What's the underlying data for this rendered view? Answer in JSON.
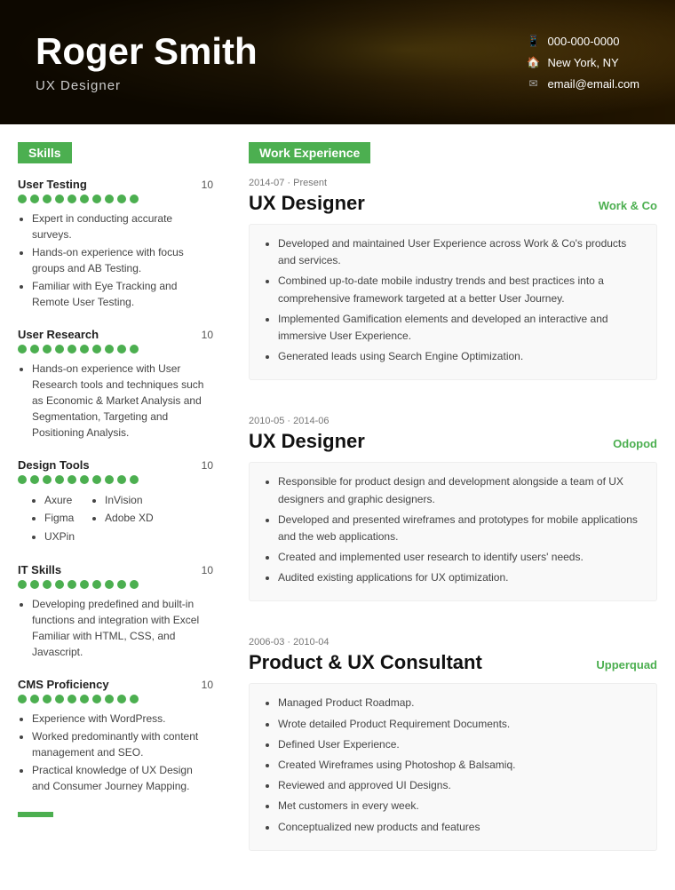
{
  "header": {
    "name": "Roger Smith",
    "title": "UX Designer",
    "phone": "000-000-0000",
    "location": "New York, NY",
    "email": "email@email.com"
  },
  "sections": {
    "skills_label": "Skills",
    "work_experience_label": "Work Experience"
  },
  "skills": [
    {
      "title": "User Testing",
      "score": "10",
      "dots": 10,
      "bullets": [
        "Expert in conducting accurate surveys.",
        "Hands-on experience with focus groups and AB Testing.",
        "Familiar with Eye Tracking and Remote User Testing."
      ],
      "tools": null
    },
    {
      "title": "User Research",
      "score": "10",
      "dots": 10,
      "bullets": [
        "Hands-on experience with User Research tools and techniques such as Economic & Market Analysis and Segmentation, Targeting and Positioning Analysis."
      ],
      "tools": null
    },
    {
      "title": "Design Tools",
      "score": "10",
      "dots": 10,
      "bullets": null,
      "tools": [
        [
          "Axure",
          "Figma",
          "UXPin"
        ],
        [
          "InVision",
          "Adobe XD"
        ]
      ]
    },
    {
      "title": "IT Skills",
      "score": "10",
      "dots": 10,
      "bullets": [
        "Developing predefined and built-in functions and integration with Excel Familiar with HTML, CSS, and Javascript."
      ],
      "tools": null
    },
    {
      "title": "CMS Proficiency",
      "score": "10",
      "dots": 10,
      "bullets": [
        "Experience with WordPress.",
        "Worked predominantly with content management and SEO.",
        "Practical knowledge of UX Design and Consumer Journey Mapping."
      ],
      "tools": null
    }
  ],
  "work_experience": [
    {
      "date_range": "2014-07 · Present",
      "title": "UX Designer",
      "company": "Work & Co",
      "bullets": [
        "Developed and maintained User Experience across Work & Co's products and services.",
        "Combined up-to-date mobile industry trends and best practices into a comprehensive framework targeted at a better User Journey.",
        "Implemented Gamification elements and developed an interactive and immersive User Experience.",
        "Generated leads using Search Engine Optimization."
      ]
    },
    {
      "date_range": "2010-05 · 2014-06",
      "title": "UX Designer",
      "company": "Odopod",
      "bullets": [
        "Responsible for product design and development alongside a team of UX designers and graphic designers.",
        "Developed and presented wireframes and prototypes for mobile applications and the web applications.",
        "Created and implemented user research to identify users' needs.",
        "Audited existing applications for UX optimization."
      ]
    },
    {
      "date_range": "2006-03 · 2010-04",
      "title": "Product & UX Consultant",
      "company": "Upperquad",
      "bullets": [
        "Managed Product Roadmap.",
        "Wrote detailed Product Requirement Documents.",
        "Defined User Experience.",
        "Created Wireframes using Photoshop & Balsamiq.",
        "Reviewed and approved UI Designs.",
        "Met customers in every week.",
        "Conceptualized new products and features"
      ]
    }
  ]
}
